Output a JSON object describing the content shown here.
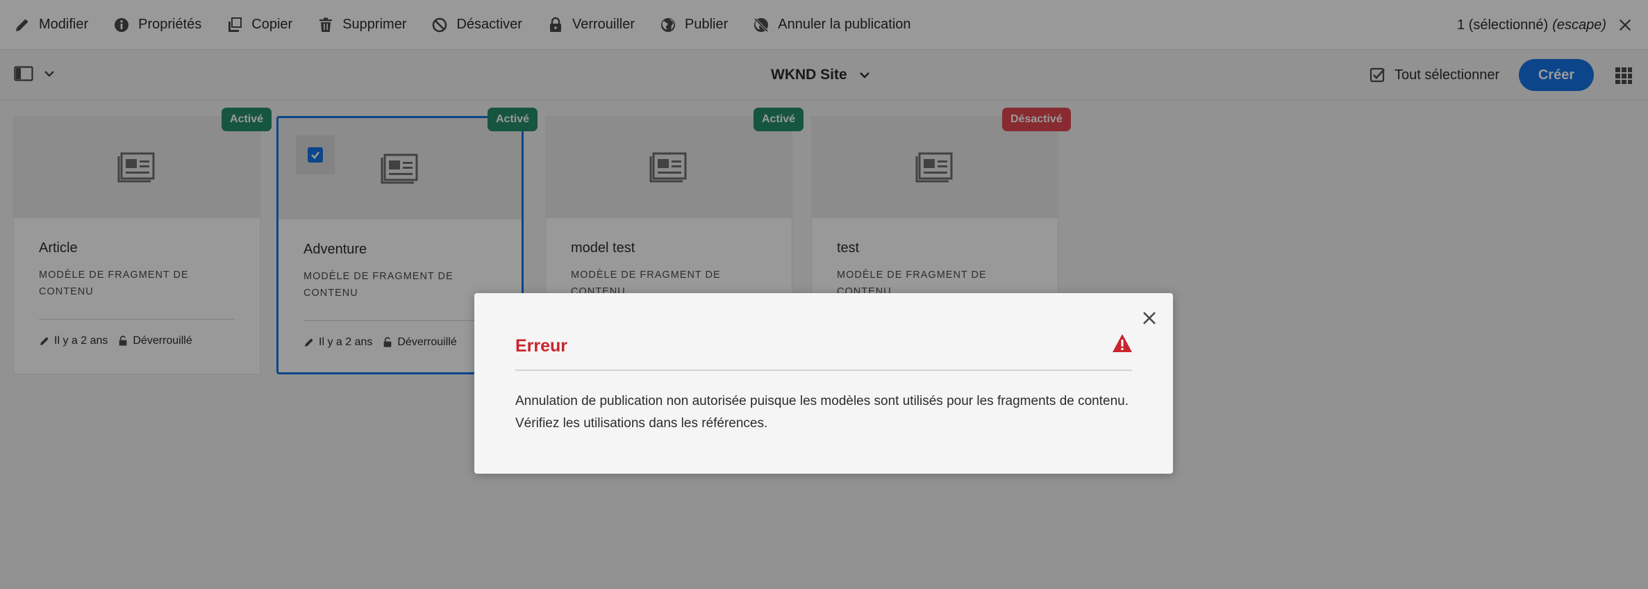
{
  "actionbar": {
    "actions": [
      {
        "label": "Modifier",
        "icon": "pencil-icon"
      },
      {
        "label": "Propriétés",
        "icon": "info-icon"
      },
      {
        "label": "Copier",
        "icon": "copy-icon"
      },
      {
        "label": "Supprimer",
        "icon": "trash-icon"
      },
      {
        "label": "Désactiver",
        "icon": "block-icon"
      },
      {
        "label": "Verrouiller",
        "icon": "lock-icon"
      },
      {
        "label": "Publier",
        "icon": "globe-icon"
      },
      {
        "label": "Annuler la publication",
        "icon": "globe-off-icon"
      }
    ],
    "selection_count": "1 (sélectionné)",
    "selection_hint": "(escape)"
  },
  "subheader": {
    "site_title": "WKND Site",
    "select_all_label": "Tout sélectionner",
    "create_label": "Créer"
  },
  "cards": [
    {
      "title": "Article",
      "subtitle": "Modèle de fragment de contenu",
      "modified": "Il y a 2 ans",
      "lock_status": "Déverrouillé",
      "status": "Activé",
      "selected": false
    },
    {
      "title": "Adventure",
      "subtitle": "Modèle de fragment de contenu",
      "modified": "Il y a 2 ans",
      "lock_status": "Déverrouillé",
      "status": "Activé",
      "selected": true
    },
    {
      "title": "model test",
      "subtitle": "Modèle de fragment de contenu",
      "modified": "",
      "lock_status": "",
      "status": "Activé",
      "selected": false
    },
    {
      "title": "test",
      "subtitle": "Modèle de fragment de contenu",
      "modified": "",
      "lock_status": "",
      "status": "Désactivé",
      "selected": false
    }
  ],
  "dialog": {
    "title": "Erreur",
    "message_line1": "Annulation de publication non autorisée puisque les modèles sont utilisés pour les fragments de contenu.",
    "message_line2": "Vérifiez les utilisations dans les références."
  },
  "colors": {
    "accent": "#1473e6",
    "status_active": "#268e6c",
    "status_inactive": "#e34850",
    "error": "#c9252d"
  }
}
